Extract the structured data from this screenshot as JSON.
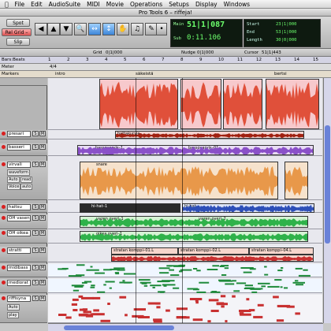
{
  "menu": [
    "File",
    "Edit",
    "AudioSuite",
    "MIDI",
    "Movie",
    "Operations",
    "Setups",
    "Display",
    "Windows"
  ],
  "window_title": "Pro Tools 6 – riffeja!",
  "toolbar": {
    "spot_label": "Spot",
    "relgrid_label": "Rel Grid –",
    "slip_label": "Slip",
    "grid_label": "Grid",
    "nudge_label": "Nudge",
    "cursor_label": "Cursor",
    "main_label": "Main",
    "main_value": "51|1|087",
    "sub_label": "Sub",
    "sub_value": "0:11.106",
    "start_label": "Start",
    "start_value": "23|1|000",
    "end_label": "End",
    "end_value": "53|1|000",
    "length_label": "Length",
    "length_value": "30|0|000",
    "grid_value": "0|1|000",
    "nudge_value": "0|1|000",
    "cursor_value": "51|1|443"
  },
  "rulers": {
    "bars_beats": "Bars:Beats",
    "meter": "Meter",
    "markers": "Markers",
    "meter_value": "4/4",
    "bar_numbers": [
      "1",
      "2",
      "3",
      "4",
      "5",
      "6",
      "7",
      "8",
      "9",
      "10",
      "11",
      "12",
      "13",
      "14",
      "15"
    ],
    "markers_list": [
      "intro",
      "säkeistä",
      "bertsi"
    ]
  },
  "tracks": [
    {
      "name": "presari",
      "clip": "battakurvie"
    },
    {
      "name": "basseri",
      "clip": "bassovarvis–1"
    },
    {
      "name": "virvali",
      "clip": "snare"
    },
    {
      "name": "haitsu",
      "clip": "hi-hat–1"
    },
    {
      "name": "OH vasen",
      "clip": "vazen overi–1"
    },
    {
      "name": "OH oikea",
      "clip": "oikea overi–1"
    },
    {
      "name": "stratti",
      "clip": "stratan komppi–01.L"
    },
    {
      "name": "midibass",
      "clip": ""
    },
    {
      "name": "mediorat",
      "clip": ""
    },
    {
      "name": "riffisyna",
      "clip": ""
    }
  ],
  "track_controls": {
    "waveform": "waveform",
    "auto_label": "Auto",
    "read_label": "read",
    "voice_label": "Voice",
    "auto_value": "auto",
    "play_label": "play",
    "clip_extra": [
      "bassovarvis–01",
      "vazen overi–2",
      "stratan komppi–02.L",
      "stratan komppi–03.L",
      "stratan komppi–04.L",
      "hi-hat"
    ]
  },
  "colors": {
    "audio_red": "#e0503a",
    "audio_purple": "#8a50c8",
    "audio_orange": "#e8984a",
    "audio_blue": "#2d4fb8",
    "audio_green": "#2fb24a",
    "midi_red": "#c83030",
    "counter_green": "#6cff6c"
  }
}
